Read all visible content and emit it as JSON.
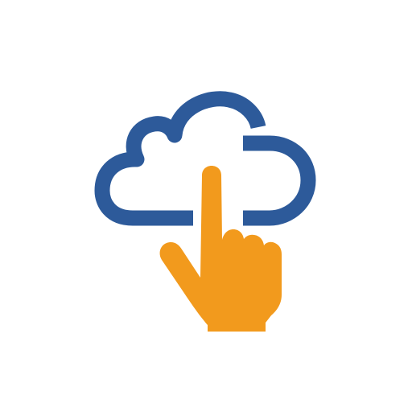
{
  "icon": {
    "name": "cloud-touch-icon",
    "parts": [
      "cloud-icon",
      "pointing-hand-icon"
    ]
  },
  "colors": {
    "background": "#ffffff",
    "cloud": "#2d5a9a",
    "hand": "#f29a1d"
  }
}
